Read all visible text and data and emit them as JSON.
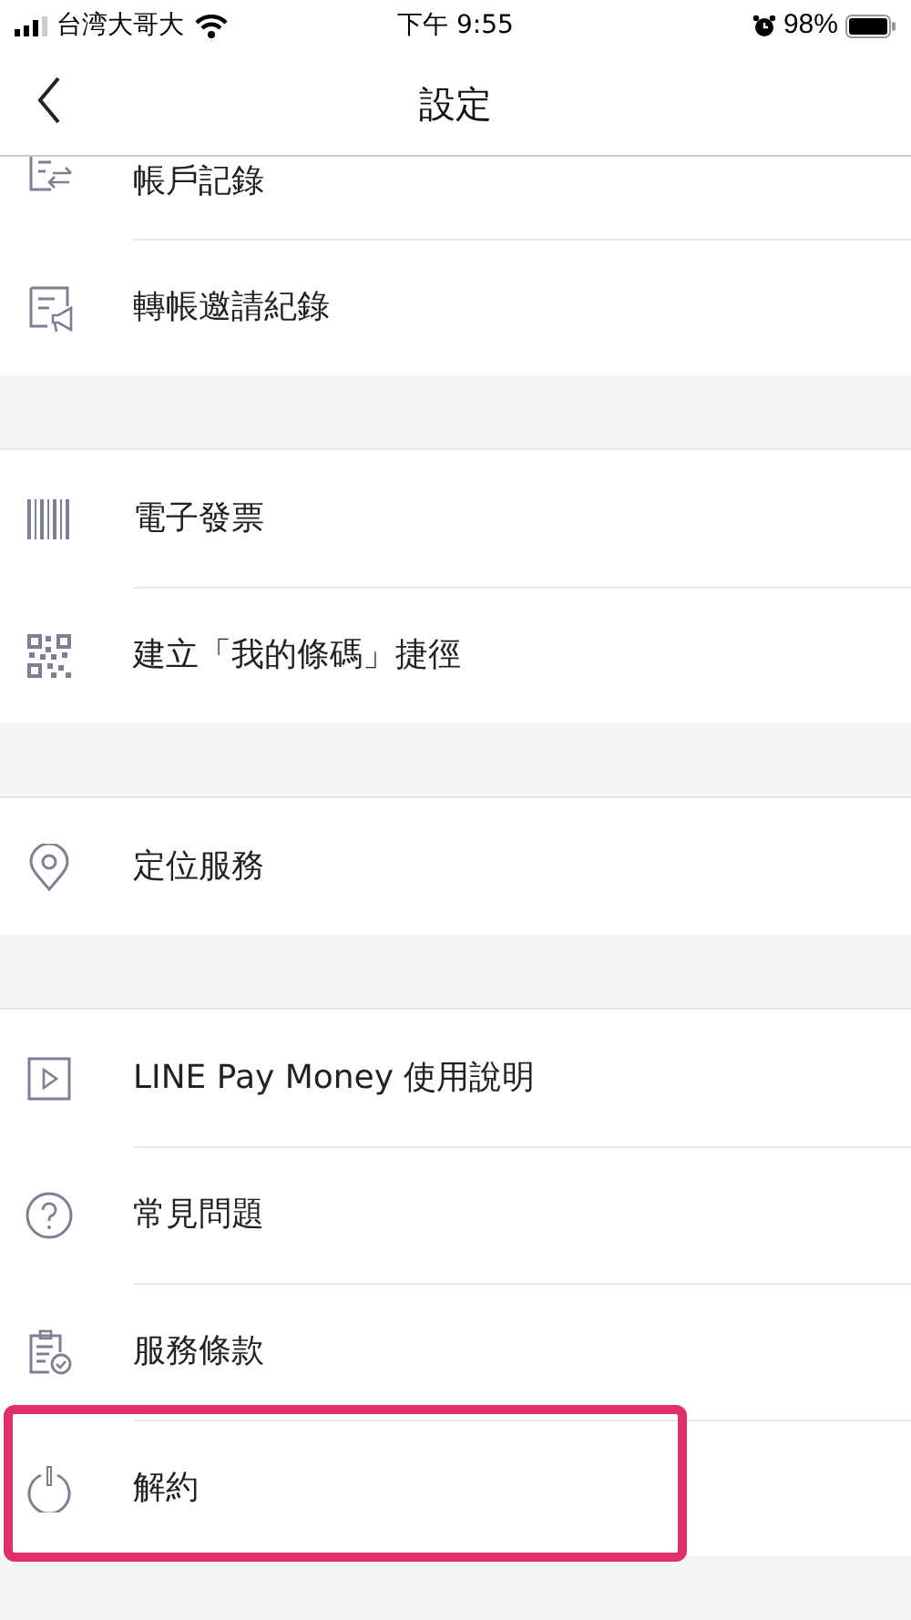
{
  "status_bar": {
    "carrier": "台湾大哥大",
    "time": "下午 9:55",
    "battery": "98%"
  },
  "header": {
    "title": "設定"
  },
  "sections": [
    {
      "items": [
        {
          "kind": "history",
          "label": "帳戶記錄",
          "highlighted": false
        },
        {
          "kind": "invite",
          "label": "轉帳邀請紀錄",
          "highlighted": false
        }
      ]
    },
    {
      "items": [
        {
          "kind": "barcode",
          "label": "電子發票",
          "highlighted": false
        },
        {
          "kind": "qrcode",
          "label": "建立「我的條碼」捷徑",
          "highlighted": false
        }
      ]
    },
    {
      "items": [
        {
          "kind": "location",
          "label": "定位服務",
          "highlighted": false
        }
      ]
    },
    {
      "items": [
        {
          "kind": "video",
          "label": "LINE Pay Money 使用說明",
          "highlighted": false
        },
        {
          "kind": "help",
          "label": "常見問題",
          "highlighted": false
        },
        {
          "kind": "terms",
          "label": "服務條款",
          "highlighted": false
        },
        {
          "kind": "power",
          "label": "解約",
          "highlighted": true
        }
      ]
    }
  ]
}
